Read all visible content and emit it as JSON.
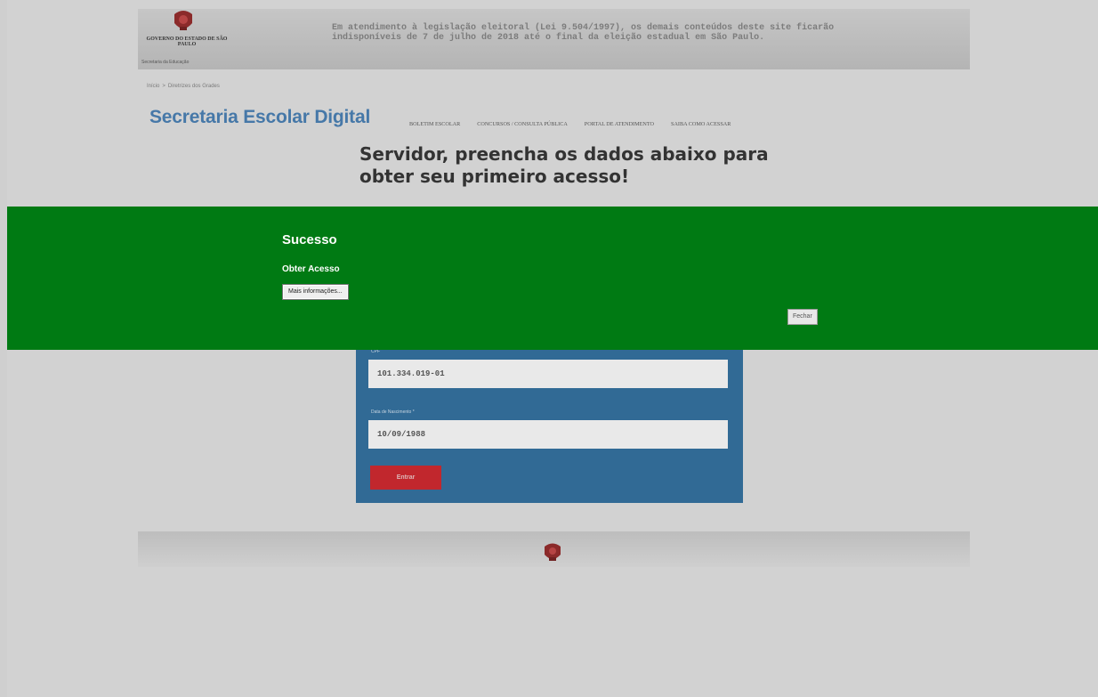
{
  "banner": {
    "gov_name": "GOVERNO DO ESTADO DE SÃO PAULO",
    "gov_dept": "Secretaria da Educação",
    "election_notice": "Em atendimento à legislação eleitoral (Lei 9.504/1997), os demais conteúdos deste site ficarão indisponíveis de 7 de julho de 2018 até o final da eleição estadual em São Paulo."
  },
  "breadcrumb": {
    "home": "Início",
    "current": "Diretrizes dos Grades"
  },
  "header": {
    "site_title": "Secretaria Escolar Digital",
    "nav": [
      "BOLETIM ESCOLAR",
      "CONCURSOS / CONSULTA PÚBLICA",
      "PORTAL DE ATENDIMENTO",
      "SAIBA COMO ACESSAR"
    ]
  },
  "main": {
    "heading": "Servidor, preencha os dados abaixo para obter seu primeiro acesso!"
  },
  "form": {
    "cpf_label": "CPF",
    "cpf_value": "101.334.019-01",
    "birth_label": "Data de Nascimento *",
    "birth_value": "10/09/1988",
    "submit_label": "Entrar"
  },
  "overlay": {
    "title": "Sucesso",
    "subtitle": "Obter Acesso",
    "more_info_label": "Mais informações...",
    "close_label": "Fechar"
  },
  "colors": {
    "overlay_bg": "#007a13",
    "panel_bg": "#316a95",
    "submit_bg": "#c1272d",
    "title": "#4678a8"
  }
}
